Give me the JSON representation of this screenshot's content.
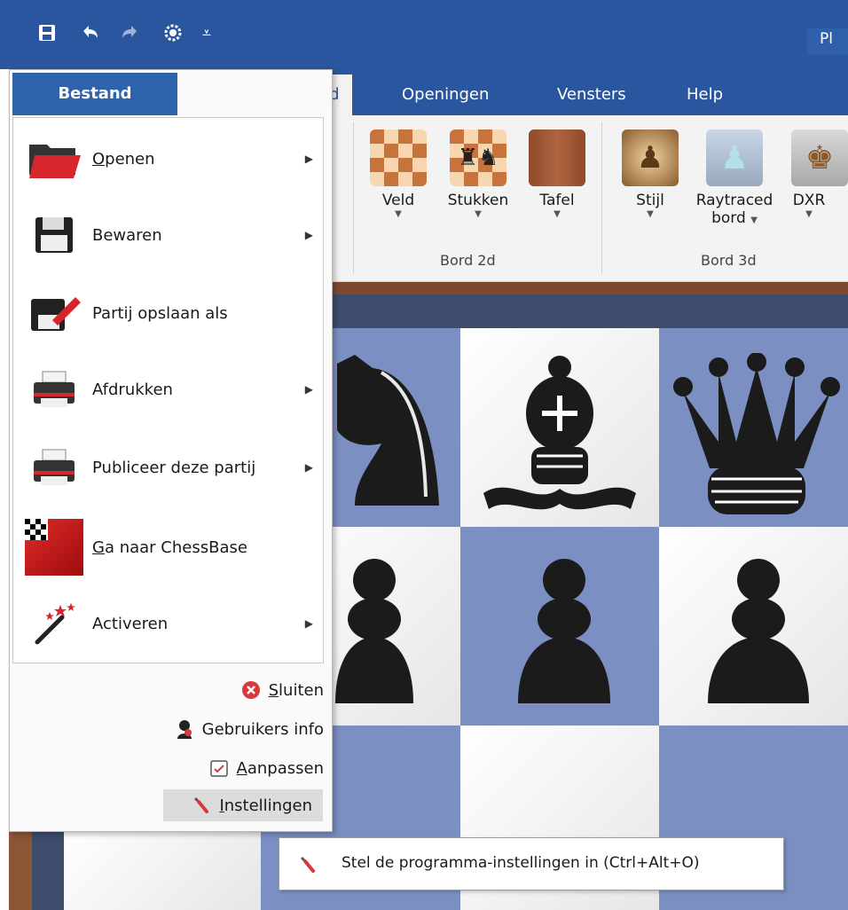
{
  "app": {
    "title_visible": "Pl",
    "brand_color": "#2a569f"
  },
  "quick_access": {
    "icons": [
      "save-icon",
      "undo-icon",
      "redo-icon",
      "engine-icon",
      "customize-dropdown-icon"
    ],
    "customize_glyph": "⩡"
  },
  "ribbon": {
    "tabs": [
      {
        "label": "rd",
        "active": true
      },
      {
        "label": "Openingen"
      },
      {
        "label": "Vensters"
      },
      {
        "label": "Help"
      }
    ],
    "groups": [
      {
        "label": "Bord 2d",
        "buttons": [
          {
            "label": "Veld"
          },
          {
            "label": "Stukken"
          },
          {
            "label": "Tafel"
          }
        ]
      },
      {
        "label": "Bord 3d",
        "buttons": [
          {
            "label": "Stijl"
          },
          {
            "label": "Raytraced",
            "label2": "bord"
          },
          {
            "label": "DXR"
          }
        ]
      }
    ]
  },
  "file_menu": {
    "tab_label": "Bestand",
    "items": [
      {
        "label": "Openen",
        "mnemonic": "O",
        "rest": "penen",
        "icon": "folder-open-icon",
        "submenu": true
      },
      {
        "label": "Bewaren",
        "icon": "floppy-disk-icon",
        "submenu": true
      },
      {
        "label": "Partij opslaan als",
        "icon": "save-as-icon",
        "submenu": false
      },
      {
        "label": "Afdrukken",
        "icon": "printer-icon",
        "submenu": true
      },
      {
        "label": "Publiceer deze partij",
        "icon": "publish-printer-icon",
        "submenu": true
      },
      {
        "label": "Ga naar ChessBase",
        "mnemonic": "G",
        "rest": "a naar ChessBase",
        "icon": "chessbase-icon",
        "submenu": false
      },
      {
        "label": "Activeren",
        "icon": "magic-wand-icon",
        "submenu": true
      }
    ],
    "footer": [
      {
        "label": "Sluiten",
        "mnemonic": "S",
        "rest": "luiten",
        "icon": "close-red-icon"
      },
      {
        "label": "Gebruikers info",
        "icon": "user-info-icon"
      },
      {
        "label": "Aanpassen",
        "mnemonic": "A",
        "rest": "anpassen",
        "icon": "customize-icon"
      },
      {
        "label": "Instellingen",
        "mnemonic": "I",
        "rest": "nstellingen",
        "icon": "wrench-icon",
        "highlighted": true
      }
    ],
    "submenu_arrow": "▶"
  },
  "tooltip": {
    "text": "Stel de programma-instellingen in (Ctrl+Alt+O)",
    "icon": "wrench-icon"
  },
  "board": {
    "visible_pieces": [
      {
        "piece": "knight",
        "color": "black"
      },
      {
        "piece": "bishop",
        "color": "black"
      },
      {
        "piece": "queen",
        "color": "black"
      },
      {
        "piece": "pawn",
        "color": "black"
      },
      {
        "piece": "pawn",
        "color": "black"
      },
      {
        "piece": "pawn",
        "color": "black"
      }
    ],
    "light_color": "#f2f2f2",
    "dark_color": "#7b8fc2"
  }
}
